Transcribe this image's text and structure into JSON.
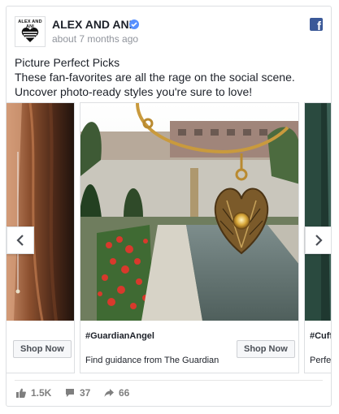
{
  "header": {
    "page_name": "ALEX AND ANI",
    "avatar_text": "ALEX AND ANI",
    "timestamp": "about 7 months ago"
  },
  "post": {
    "title": "Picture Perfect Picks",
    "body": "These fan-favorites are all the rage on the social scene. Uncover photo-ready styles you're sure to love!"
  },
  "carousel": {
    "cards": [
      {
        "title": "",
        "description": "",
        "button": "Shop Now"
      },
      {
        "title": "#GuardianAngel",
        "description": "Find guidance from The Guardian",
        "button": "Shop Now"
      },
      {
        "title": "#Cuffs",
        "description": "Perfec"
      }
    ]
  },
  "stats": {
    "likes": "1.5K",
    "comments": "37",
    "shares": "66"
  },
  "colors": {
    "facebook": "#3b5998",
    "verified": "#5890ff",
    "muted": "#90949c"
  },
  "icons": [
    "verified-badge-icon",
    "facebook-logo-icon",
    "chevron-left-icon",
    "chevron-right-icon",
    "like-icon",
    "comment-icon",
    "share-icon"
  ]
}
